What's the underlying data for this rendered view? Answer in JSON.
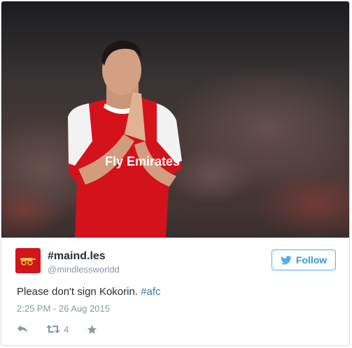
{
  "tweet": {
    "display_name": "#maind.les",
    "handle": "@mindlessworldd",
    "follow_label": "Follow",
    "text": "Please don't sign Kokorin. ",
    "hashtag": "#afc",
    "timestamp": "2:25 PM - 26 Aug 2015",
    "retweet_count": "4"
  },
  "icons": {
    "reply": "reply-icon",
    "retweet": "retweet-icon",
    "favorite": "star-icon",
    "follow": "twitter-bird-icon",
    "avatar": "arsenal-cannon-icon"
  },
  "colors": {
    "accent": "#55acee",
    "link": "#2b7bb9",
    "avatar_bg": "#d3141b",
    "kit_red": "#d3121b"
  }
}
